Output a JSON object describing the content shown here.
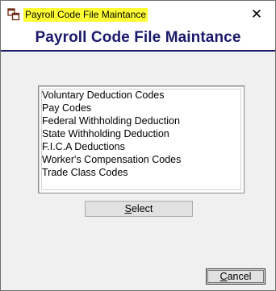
{
  "window": {
    "title": "Payroll Code File Maintance",
    "close_glyph": "✕",
    "icon": "app-window-icon",
    "title_highlight_color": "#ffff33"
  },
  "header": {
    "title": "Payroll Code File Maintance",
    "color": "#1a1a6b"
  },
  "list": {
    "items": [
      "Voluntary Deduction Codes",
      "Pay Codes",
      "Federal Withholding Deduction",
      "State Withholding Deduction",
      "F.I.C.A Deductions",
      "Worker's Compensation Codes",
      "Trade Class Codes"
    ]
  },
  "buttons": {
    "select_mnemonic": "S",
    "select_rest": "elect",
    "cancel_mnemonic": "C",
    "cancel_rest": "ancel"
  }
}
